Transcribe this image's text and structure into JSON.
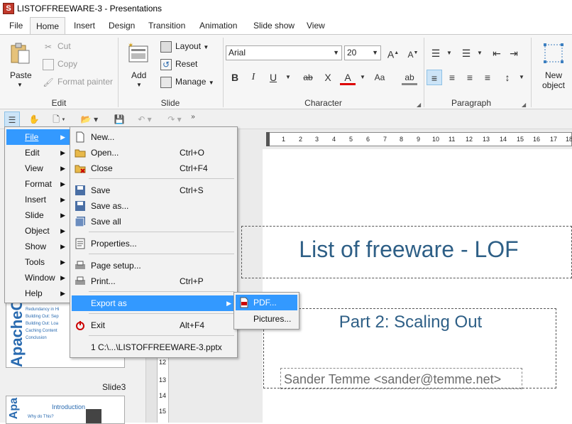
{
  "window": {
    "title": "LISTOFFREEWARE-3 - Presentations",
    "app_icon_letter": "S"
  },
  "tabs": [
    "File",
    "Home",
    "Insert",
    "Design",
    "Transition",
    "Animation",
    "Slide show",
    "View"
  ],
  "ribbon": {
    "edit": {
      "paste": "Paste",
      "cut": "Cut",
      "copy": "Copy",
      "format_painter": "Format painter",
      "label": "Edit"
    },
    "slide": {
      "add": "Add",
      "layout": "Layout",
      "reset": "Reset",
      "manage": "Manage",
      "label": "Slide"
    },
    "character": {
      "font": "Arial",
      "size": "20",
      "label": "Character",
      "bold": "B",
      "italic": "I",
      "underline": "U",
      "grow": "A",
      "shrink": "A",
      "strike": "ab",
      "clear": "X",
      "color": "A",
      "case": "Aa",
      "highlight": "ab"
    },
    "paragraph": {
      "label": "Paragraph"
    },
    "object": {
      "new_object": "New object"
    }
  },
  "main_menu": [
    {
      "label": "File",
      "active": true
    },
    {
      "label": "Edit"
    },
    {
      "label": "View"
    },
    {
      "label": "Format"
    },
    {
      "label": "Insert"
    },
    {
      "label": "Slide"
    },
    {
      "label": "Object"
    },
    {
      "label": "Show"
    },
    {
      "label": "Tools"
    },
    {
      "label": "Window"
    },
    {
      "label": "Help"
    }
  ],
  "file_menu": [
    {
      "label": "New...",
      "shortcut": ""
    },
    {
      "label": "Open...",
      "shortcut": "Ctrl+O"
    },
    {
      "label": "Close",
      "shortcut": "Ctrl+F4"
    },
    {
      "label": "Save",
      "shortcut": "Ctrl+S"
    },
    {
      "label": "Save as...",
      "shortcut": ""
    },
    {
      "label": "Save all",
      "shortcut": ""
    },
    {
      "label": "Properties...",
      "shortcut": ""
    },
    {
      "label": "Page setup...",
      "shortcut": ""
    },
    {
      "label": "Print...",
      "shortcut": "Ctrl+P"
    },
    {
      "label": "Export as",
      "shortcut": ""
    },
    {
      "label": "Exit",
      "shortcut": "Alt+F4"
    },
    {
      "label": "1 C:\\...\\LISTOFFREEWARE-3.pptx",
      "shortcut": ""
    }
  ],
  "export_menu": [
    {
      "label": "PDF..."
    },
    {
      "label": "Pictures..."
    }
  ],
  "slide": {
    "title": "List of freeware - LOF",
    "subtitle": "Part 2: Scaling Out",
    "author": "Sander Temme <sander@temme.net>"
  },
  "thumbnails": {
    "slide2_bullets": [
      "Redundancy in Hi",
      "Building Out: Sep",
      "Building Out: Loa",
      "Caching Content",
      "Conclusion"
    ],
    "slide2_logo": "ApacheCon",
    "slide3_label": "Slide3",
    "slide3_title": "Introduction",
    "slide3_bullet": "Why do This?"
  },
  "rulers": {
    "h_ticks": [
      "1",
      "2",
      "3",
      "4",
      "5",
      "6",
      "7",
      "8",
      "9",
      "10",
      "11",
      "12",
      "13",
      "14",
      "15",
      "16",
      "17",
      "18"
    ],
    "v_ticks": [
      "12",
      "13",
      "14",
      "15"
    ]
  },
  "colors": {
    "accent": "#3399ff",
    "slide_text": "#2e5f86",
    "ribbon_bg": "#f6f6f6"
  }
}
